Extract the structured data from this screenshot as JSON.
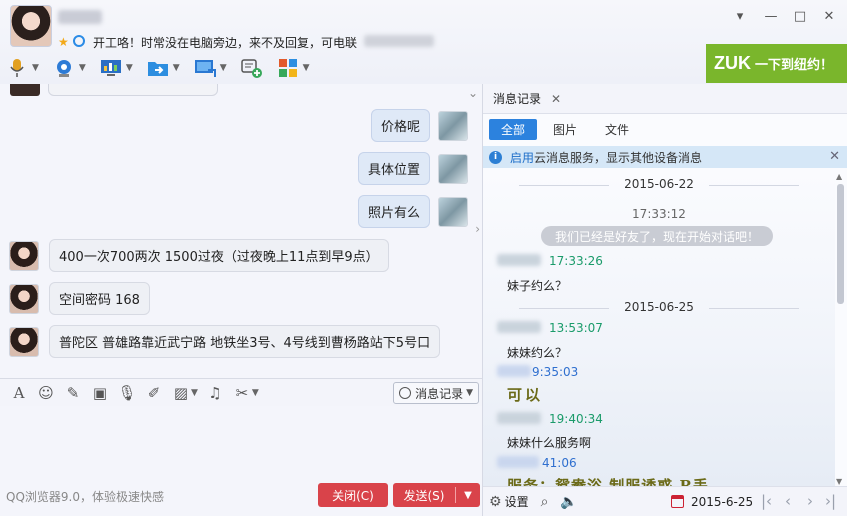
{
  "header": {
    "status_text": "开工咯！时常没在电脑旁边，来不及回复，可电联",
    "toolbar": [
      {
        "name": "microphone-icon",
        "color": "#e2a020"
      },
      {
        "name": "camera-icon",
        "color": "#2d7bd6"
      },
      {
        "name": "screen-share-icon",
        "color": "#2a6fc4"
      },
      {
        "name": "file-transfer-icon",
        "color": "#2d8ee0"
      },
      {
        "name": "remote-desktop-icon",
        "color": "#2a78d2"
      },
      {
        "name": "add-chat-icon",
        "color": "#37a85a"
      },
      {
        "name": "apps-icon",
        "color": "#e25a2b"
      }
    ],
    "ad": {
      "brand": "ZUK",
      "slogan": "一下到纽约！",
      "color": "#7ab62c"
    }
  },
  "window_controls": {
    "dropdown": "▾",
    "minimize": "—",
    "maximize": "□",
    "close": "✕"
  },
  "chat": {
    "messages": [
      {
        "from": "me",
        "text": "价格呢"
      },
      {
        "from": "me",
        "text": "具体位置"
      },
      {
        "from": "me",
        "text": "照片有么"
      },
      {
        "from": "her",
        "text": "400一次700两次 1500过夜（过夜晚上11点到早9点）"
      },
      {
        "from": "her",
        "text": "空间密码 168"
      },
      {
        "from": "her",
        "text": "普陀区 普雄路靠近武宁路 地铁坐3号、4号线到曹杨路站下5号口"
      }
    ]
  },
  "input_toolbar": {
    "history_button": "消息记录"
  },
  "footer": {
    "hint": "QQ浏览器9.0，体验极速快感",
    "close_button": "关闭(C)",
    "send_button": "发送(S)"
  },
  "history": {
    "tab_title": "消息记录",
    "filters": [
      "全部",
      "图片",
      "文件"
    ],
    "active_filter": "全部",
    "notice": {
      "link": "启用",
      "text": "云消息服务，显示其他设备消息"
    },
    "entries": {
      "date1": "2015-06-22",
      "sys_time": "17:33:12",
      "sys_msg": "我们已经是好友了，现在开始对话吧！",
      "t1": "17:33:26",
      "m1": "妹子约么？",
      "date2": "2015-06-25",
      "t2": "13:53:07",
      "m2": "妹妹约么？",
      "t3": "9:35:03",
      "m3": "可以",
      "t4": "19:40:34",
      "m4": "妹妹什么服务啊",
      "t5": "41:06",
      "m5": "服务：鸳鸯浴  制服诱惑  R丢"
    },
    "footer": {
      "settings": "设置",
      "date": "2015-6-25"
    }
  }
}
